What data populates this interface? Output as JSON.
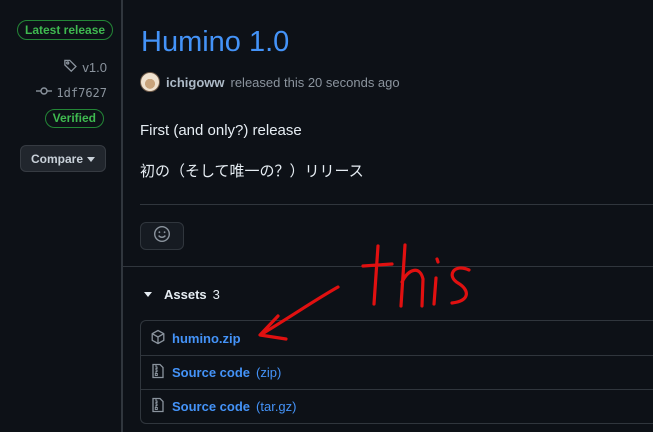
{
  "sidebar": {
    "latest_badge": "Latest release",
    "tag": "v1.0",
    "commit": "1df7627",
    "verified_badge": "Verified",
    "compare_label": "Compare"
  },
  "release": {
    "title": "Humino 1.0",
    "author": "ichigoww",
    "released_text": "released this 20 seconds ago",
    "body_lines": [
      "First (and only?) release",
      "初の（そして唯一の？）リリース"
    ]
  },
  "assets": {
    "label": "Assets",
    "count": "3",
    "items": [
      {
        "name": "humino.zip",
        "suffix": "",
        "icon": "package-icon"
      },
      {
        "name": "Source code",
        "suffix": "(zip)",
        "icon": "file-zip-icon"
      },
      {
        "name": "Source code",
        "suffix": "(tar.gz)",
        "icon": "file-zip-icon"
      }
    ]
  },
  "annotation": {
    "text": "this",
    "color": "#e01010"
  },
  "colors": {
    "background": "#0d1117",
    "link": "#4493f8",
    "success": "#3fb950",
    "border": "#30363d"
  }
}
